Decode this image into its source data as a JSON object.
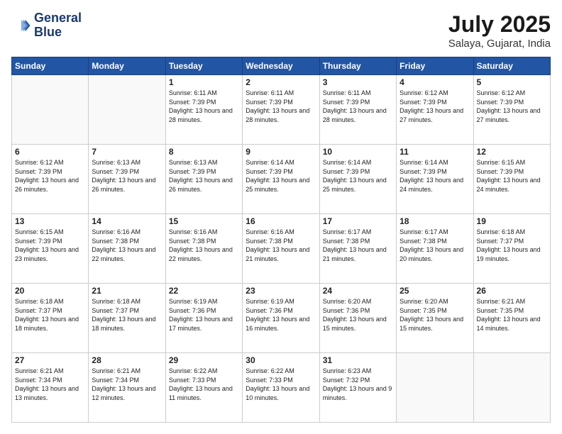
{
  "logo": {
    "line1": "General",
    "line2": "Blue"
  },
  "title": "July 2025",
  "location": "Salaya, Gujarat, India",
  "weekdays": [
    "Sunday",
    "Monday",
    "Tuesday",
    "Wednesday",
    "Thursday",
    "Friday",
    "Saturday"
  ],
  "weeks": [
    [
      {
        "day": "",
        "info": ""
      },
      {
        "day": "",
        "info": ""
      },
      {
        "day": "1",
        "info": "Sunrise: 6:11 AM\nSunset: 7:39 PM\nDaylight: 13 hours and 28 minutes."
      },
      {
        "day": "2",
        "info": "Sunrise: 6:11 AM\nSunset: 7:39 PM\nDaylight: 13 hours and 28 minutes."
      },
      {
        "day": "3",
        "info": "Sunrise: 6:11 AM\nSunset: 7:39 PM\nDaylight: 13 hours and 28 minutes."
      },
      {
        "day": "4",
        "info": "Sunrise: 6:12 AM\nSunset: 7:39 PM\nDaylight: 13 hours and 27 minutes."
      },
      {
        "day": "5",
        "info": "Sunrise: 6:12 AM\nSunset: 7:39 PM\nDaylight: 13 hours and 27 minutes."
      }
    ],
    [
      {
        "day": "6",
        "info": "Sunrise: 6:12 AM\nSunset: 7:39 PM\nDaylight: 13 hours and 26 minutes."
      },
      {
        "day": "7",
        "info": "Sunrise: 6:13 AM\nSunset: 7:39 PM\nDaylight: 13 hours and 26 minutes."
      },
      {
        "day": "8",
        "info": "Sunrise: 6:13 AM\nSunset: 7:39 PM\nDaylight: 13 hours and 26 minutes."
      },
      {
        "day": "9",
        "info": "Sunrise: 6:14 AM\nSunset: 7:39 PM\nDaylight: 13 hours and 25 minutes."
      },
      {
        "day": "10",
        "info": "Sunrise: 6:14 AM\nSunset: 7:39 PM\nDaylight: 13 hours and 25 minutes."
      },
      {
        "day": "11",
        "info": "Sunrise: 6:14 AM\nSunset: 7:39 PM\nDaylight: 13 hours and 24 minutes."
      },
      {
        "day": "12",
        "info": "Sunrise: 6:15 AM\nSunset: 7:39 PM\nDaylight: 13 hours and 24 minutes."
      }
    ],
    [
      {
        "day": "13",
        "info": "Sunrise: 6:15 AM\nSunset: 7:39 PM\nDaylight: 13 hours and 23 minutes."
      },
      {
        "day": "14",
        "info": "Sunrise: 6:16 AM\nSunset: 7:38 PM\nDaylight: 13 hours and 22 minutes."
      },
      {
        "day": "15",
        "info": "Sunrise: 6:16 AM\nSunset: 7:38 PM\nDaylight: 13 hours and 22 minutes."
      },
      {
        "day": "16",
        "info": "Sunrise: 6:16 AM\nSunset: 7:38 PM\nDaylight: 13 hours and 21 minutes."
      },
      {
        "day": "17",
        "info": "Sunrise: 6:17 AM\nSunset: 7:38 PM\nDaylight: 13 hours and 21 minutes."
      },
      {
        "day": "18",
        "info": "Sunrise: 6:17 AM\nSunset: 7:38 PM\nDaylight: 13 hours and 20 minutes."
      },
      {
        "day": "19",
        "info": "Sunrise: 6:18 AM\nSunset: 7:37 PM\nDaylight: 13 hours and 19 minutes."
      }
    ],
    [
      {
        "day": "20",
        "info": "Sunrise: 6:18 AM\nSunset: 7:37 PM\nDaylight: 13 hours and 18 minutes."
      },
      {
        "day": "21",
        "info": "Sunrise: 6:18 AM\nSunset: 7:37 PM\nDaylight: 13 hours and 18 minutes."
      },
      {
        "day": "22",
        "info": "Sunrise: 6:19 AM\nSunset: 7:36 PM\nDaylight: 13 hours and 17 minutes."
      },
      {
        "day": "23",
        "info": "Sunrise: 6:19 AM\nSunset: 7:36 PM\nDaylight: 13 hours and 16 minutes."
      },
      {
        "day": "24",
        "info": "Sunrise: 6:20 AM\nSunset: 7:36 PM\nDaylight: 13 hours and 15 minutes."
      },
      {
        "day": "25",
        "info": "Sunrise: 6:20 AM\nSunset: 7:35 PM\nDaylight: 13 hours and 15 minutes."
      },
      {
        "day": "26",
        "info": "Sunrise: 6:21 AM\nSunset: 7:35 PM\nDaylight: 13 hours and 14 minutes."
      }
    ],
    [
      {
        "day": "27",
        "info": "Sunrise: 6:21 AM\nSunset: 7:34 PM\nDaylight: 13 hours and 13 minutes."
      },
      {
        "day": "28",
        "info": "Sunrise: 6:21 AM\nSunset: 7:34 PM\nDaylight: 13 hours and 12 minutes."
      },
      {
        "day": "29",
        "info": "Sunrise: 6:22 AM\nSunset: 7:33 PM\nDaylight: 13 hours and 11 minutes."
      },
      {
        "day": "30",
        "info": "Sunrise: 6:22 AM\nSunset: 7:33 PM\nDaylight: 13 hours and 10 minutes."
      },
      {
        "day": "31",
        "info": "Sunrise: 6:23 AM\nSunset: 7:32 PM\nDaylight: 13 hours and 9 minutes."
      },
      {
        "day": "",
        "info": ""
      },
      {
        "day": "",
        "info": ""
      }
    ]
  ]
}
